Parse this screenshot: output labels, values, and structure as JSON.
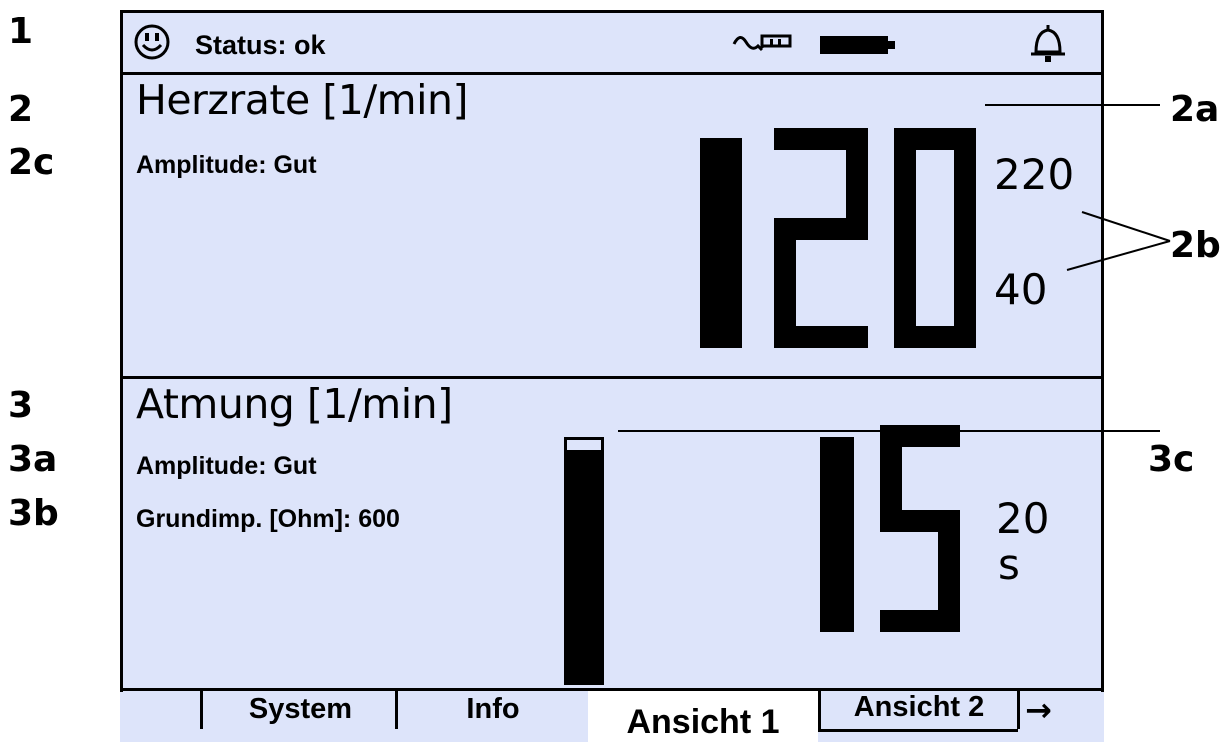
{
  "callouts": {
    "c1": "1",
    "c2": "2",
    "c2c": "2c",
    "c3": "3",
    "c3a": "3a",
    "c3b": "3b",
    "c2a": "2a",
    "c2b": "2b",
    "c3c": "3c"
  },
  "status": {
    "text": "Status: ok",
    "icons": [
      "smiley-icon",
      "ecg-wave-icon",
      "battery-icon",
      "bell-icon"
    ]
  },
  "heart_rate": {
    "title": "Herzrate [1/min]",
    "amplitude": "Amplitude: Gut",
    "value": "120",
    "upper_limit": "220",
    "lower_limit": "40"
  },
  "respiration": {
    "title": "Atmung [1/min]",
    "amplitude": "Amplitude: Gut",
    "base_impedance": "Grundimp. [Ohm]: 600",
    "value": "15",
    "interval_value": "20",
    "interval_unit": "s"
  },
  "tabs": [
    {
      "label": "System",
      "active": false
    },
    {
      "label": "Info",
      "active": false
    },
    {
      "label": "Ansicht 1",
      "active": true
    },
    {
      "label": "Ansicht 2",
      "active": false
    }
  ],
  "tab_next": "→",
  "colors": {
    "screen_bg": "#dde4fa",
    "foreground": "#000000",
    "page_bg": "#ffffff"
  }
}
